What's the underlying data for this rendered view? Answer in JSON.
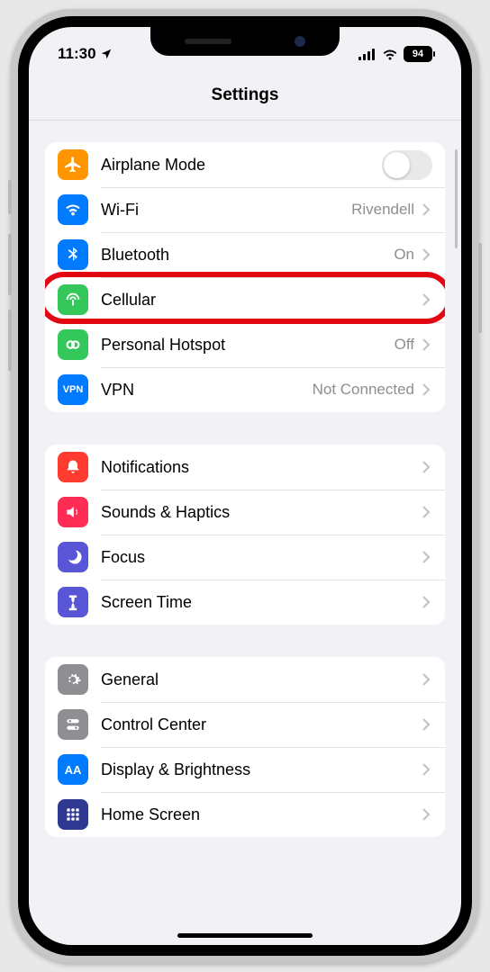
{
  "status": {
    "time": "11:30",
    "battery": "94"
  },
  "header": {
    "title": "Settings"
  },
  "g1": {
    "airplane": {
      "label": "Airplane Mode"
    },
    "wifi": {
      "label": "Wi-Fi",
      "value": "Rivendell"
    },
    "bt": {
      "label": "Bluetooth",
      "value": "On"
    },
    "cell": {
      "label": "Cellular"
    },
    "hotspot": {
      "label": "Personal Hotspot",
      "value": "Off"
    },
    "vpn": {
      "label": "VPN",
      "value": "Not Connected",
      "badge": "VPN"
    }
  },
  "g2": {
    "notif": {
      "label": "Notifications"
    },
    "sounds": {
      "label": "Sounds & Haptics"
    },
    "focus": {
      "label": "Focus"
    },
    "screentime": {
      "label": "Screen Time"
    }
  },
  "g3": {
    "general": {
      "label": "General"
    },
    "cc": {
      "label": "Control Center"
    },
    "display": {
      "label": "Display & Brightness"
    },
    "home": {
      "label": "Home Screen"
    }
  },
  "colors": {
    "orange": "#ff9500",
    "blue": "#007aff",
    "green": "#34c759",
    "red": "#ff3b30",
    "pink": "#ff2d55",
    "indigo": "#5856d6",
    "gray": "#8e8e93"
  }
}
